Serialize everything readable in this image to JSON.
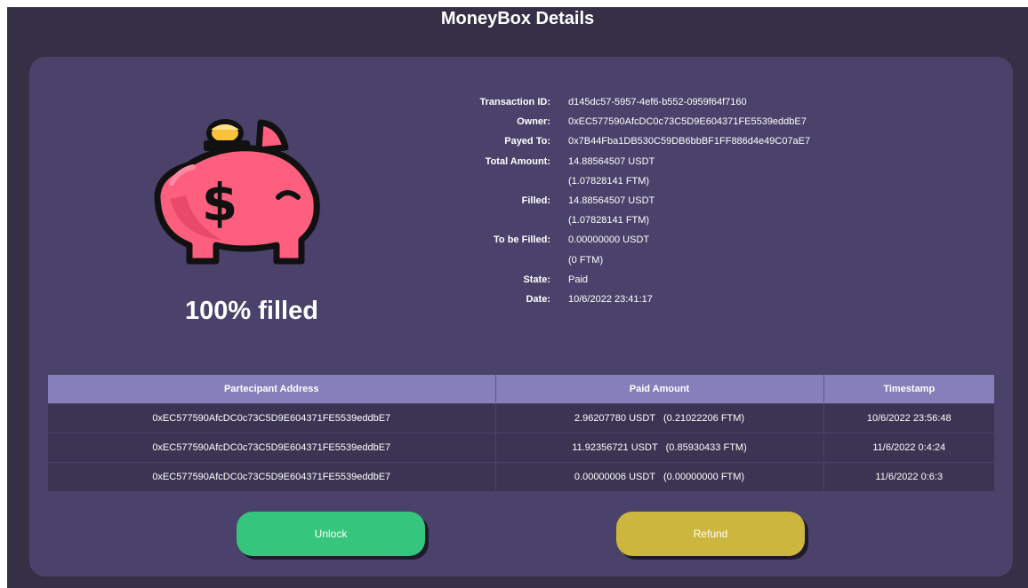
{
  "page": {
    "title": "MoneyBox Details"
  },
  "summary": {
    "fill_text": "100% filled",
    "fill_percent": 100,
    "icon": "piggy-bank-dollar-icon"
  },
  "details": [
    {
      "label": "Transaction ID:",
      "value": "d145dc57-5957-4ef6-b552-0959f64f7160"
    },
    {
      "label": "Owner:",
      "value": "0xEC577590AfcDC0c73C5D9E604371FE5539eddbE7"
    },
    {
      "label": "Payed To:",
      "value": "0x7B44Fba1DB530C59DB6bbBF1FF886d4e49C07aE7"
    },
    {
      "label": "Total Amount:",
      "value": "14.88564507 USDT"
    },
    {
      "label": "",
      "value": "(1.07828141 FTM)"
    },
    {
      "label": "Filled:",
      "value": "14.88564507 USDT"
    },
    {
      "label": "",
      "value": "(1.07828141 FTM)"
    },
    {
      "label": "To be Filled:",
      "value": "0.00000000 USDT"
    },
    {
      "label": "",
      "value": "(0 FTM)"
    },
    {
      "label": "State:",
      "value": "Paid"
    },
    {
      "label": "Date:",
      "value": "10/6/2022 23:41:17"
    }
  ],
  "table": {
    "headers": [
      "Partecipant Address",
      "Paid Amount",
      "Timestamp"
    ],
    "rows": [
      [
        "0xEC577590AfcDC0c73C5D9E604371FE5539eddbE7",
        "2.96207780 USDT   (0.21022206 FTM)",
        "10/6/2022 23:56:48"
      ],
      [
        "0xEC577590AfcDC0c73C5D9E604371FE5539eddbE7",
        "11.92356721 USDT   (0.85930433 FTM)",
        "11/6/2022 0:4:24"
      ],
      [
        "0xEC577590AfcDC0c73C5D9E604371FE5539eddbE7",
        "0.00000006 USDT   (0.00000000 FTM)",
        "11/6/2022 0:6:3"
      ]
    ]
  },
  "actions": {
    "unlock_label": "Unlock",
    "refund_label": "Refund"
  },
  "colors": {
    "background": "#363047",
    "card": "#4a426a",
    "table_header": "#8580b9",
    "table_row": "#3b3452",
    "unlock": "#35c57d",
    "refund": "#cdb63e",
    "piggy": "#ff5f7e"
  }
}
